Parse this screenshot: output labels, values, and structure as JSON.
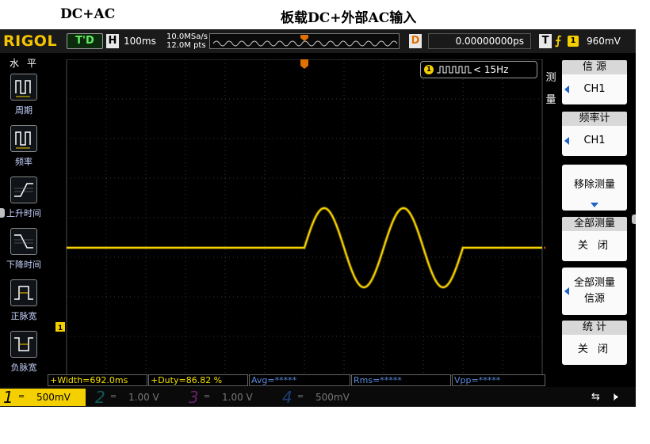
{
  "captions": {
    "left": "DC+AC",
    "center": "板载DC+外部AC输入"
  },
  "topbar": {
    "brand": "RIGOL",
    "run_state": "T'D",
    "horizontal": {
      "label": "H",
      "timebase": "100ms"
    },
    "sample_rate": "10.0MSa/s",
    "memory_depth": "12.0M pts",
    "delay": {
      "label": "D",
      "value": "0.00000000ps"
    },
    "trigger": {
      "label": "T",
      "source": "1",
      "level": "960mV"
    }
  },
  "left_menu": {
    "title": "水 平",
    "items": [
      {
        "label": "周期"
      },
      {
        "label": "频率"
      },
      {
        "label": "上升时间"
      },
      {
        "label": "下降时间"
      },
      {
        "label": "正脉宽"
      },
      {
        "label": "负脉宽"
      }
    ]
  },
  "freq_counter": {
    "channel": "1",
    "text": "< 15Hz"
  },
  "right_panel": {
    "side_label_1": "测",
    "side_label_2": "量",
    "source_head": "信 源",
    "source_value": "CH1",
    "counter_head": "频率计",
    "counter_value": "CH1",
    "remove_button": "移除测量",
    "all_meas_head": "全部测量",
    "all_meas_value": "关 闭",
    "all_meas_source_1": "全部测量",
    "all_meas_source_2": "信源",
    "stats_head": "统 计",
    "stats_value": "关 闭"
  },
  "measurements": [
    {
      "text": "+Width=692.0ms"
    },
    {
      "text": "+Duty=86.82 %"
    },
    {
      "text": "Avg=*****"
    },
    {
      "text": "Rms=*****"
    },
    {
      "text": "Vpp=*****"
    }
  ],
  "channels": [
    {
      "num": "1",
      "scale": "500mV"
    },
    {
      "num": "2",
      "scale": "1.00 V"
    },
    {
      "num": "3",
      "scale": "1.00 V"
    },
    {
      "num": "4",
      "scale": "500mV"
    }
  ],
  "markers": {
    "trigger_pos": "T",
    "ch1_ground": "1",
    "trigger_level": "T"
  },
  "colors": {
    "brand": "#f5c400",
    "ch1": "#f5d000",
    "ch2": "#00c8c8",
    "ch3": "#e040e0",
    "ch4": "#2e7fff",
    "grid": "#4a4a4a",
    "panel": "#fafafa"
  },
  "waveform": {
    "description_units": "divisions",
    "baseline_div": 0.0,
    "sine_start_div": 6.0,
    "sine_cycles": 2,
    "sine_period_div": 2.0,
    "sine_amplitude_div": 1.0
  }
}
